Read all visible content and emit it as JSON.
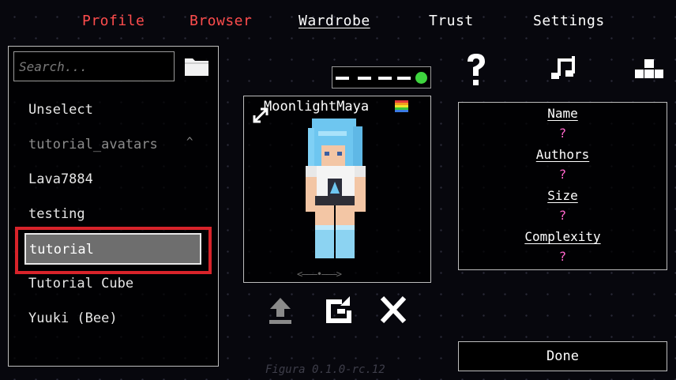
{
  "tabs": [
    {
      "label": "Profile",
      "state": "red"
    },
    {
      "label": "Browser",
      "state": "red"
    },
    {
      "label": "Wardrobe",
      "state": "active"
    },
    {
      "label": "Trust",
      "state": "normal"
    },
    {
      "label": "Settings",
      "state": "normal"
    }
  ],
  "search": {
    "placeholder": "Search..."
  },
  "avatar_list": {
    "items": [
      {
        "label": "Unselect"
      },
      {
        "label": "tutorial_avatars",
        "expanded": true
      },
      {
        "label": "Lava7884"
      },
      {
        "label": "testing"
      },
      {
        "label": "tutorial",
        "selected": true
      },
      {
        "label": "Tutorial Cube"
      },
      {
        "label": "Yuuki (Bee)"
      }
    ],
    "collapse_glyph": "^"
  },
  "preview": {
    "name": "MoonlightMaya",
    "slider_glyph": "<———•———>"
  },
  "info": {
    "name_label": "Name",
    "name_value": "?",
    "authors_label": "Authors",
    "authors_value": "?",
    "size_label": "Size",
    "size_value": "?",
    "complexity_label": "Complexity",
    "complexity_value": "?"
  },
  "buttons": {
    "done": "Done"
  },
  "version": "Figura 0.1.0-rc.12",
  "colors": {
    "accent_red": "#ff4d4d",
    "status_green": "#3ed53e",
    "value_pink": "#ff66cc",
    "highlight_red": "#d8232a"
  },
  "icons": [
    "folder-icon",
    "help-icon",
    "sound-icon",
    "keybinds-icon",
    "expand-icon",
    "pride-flag-icon",
    "upload-icon",
    "reload-icon",
    "delete-icon"
  ]
}
